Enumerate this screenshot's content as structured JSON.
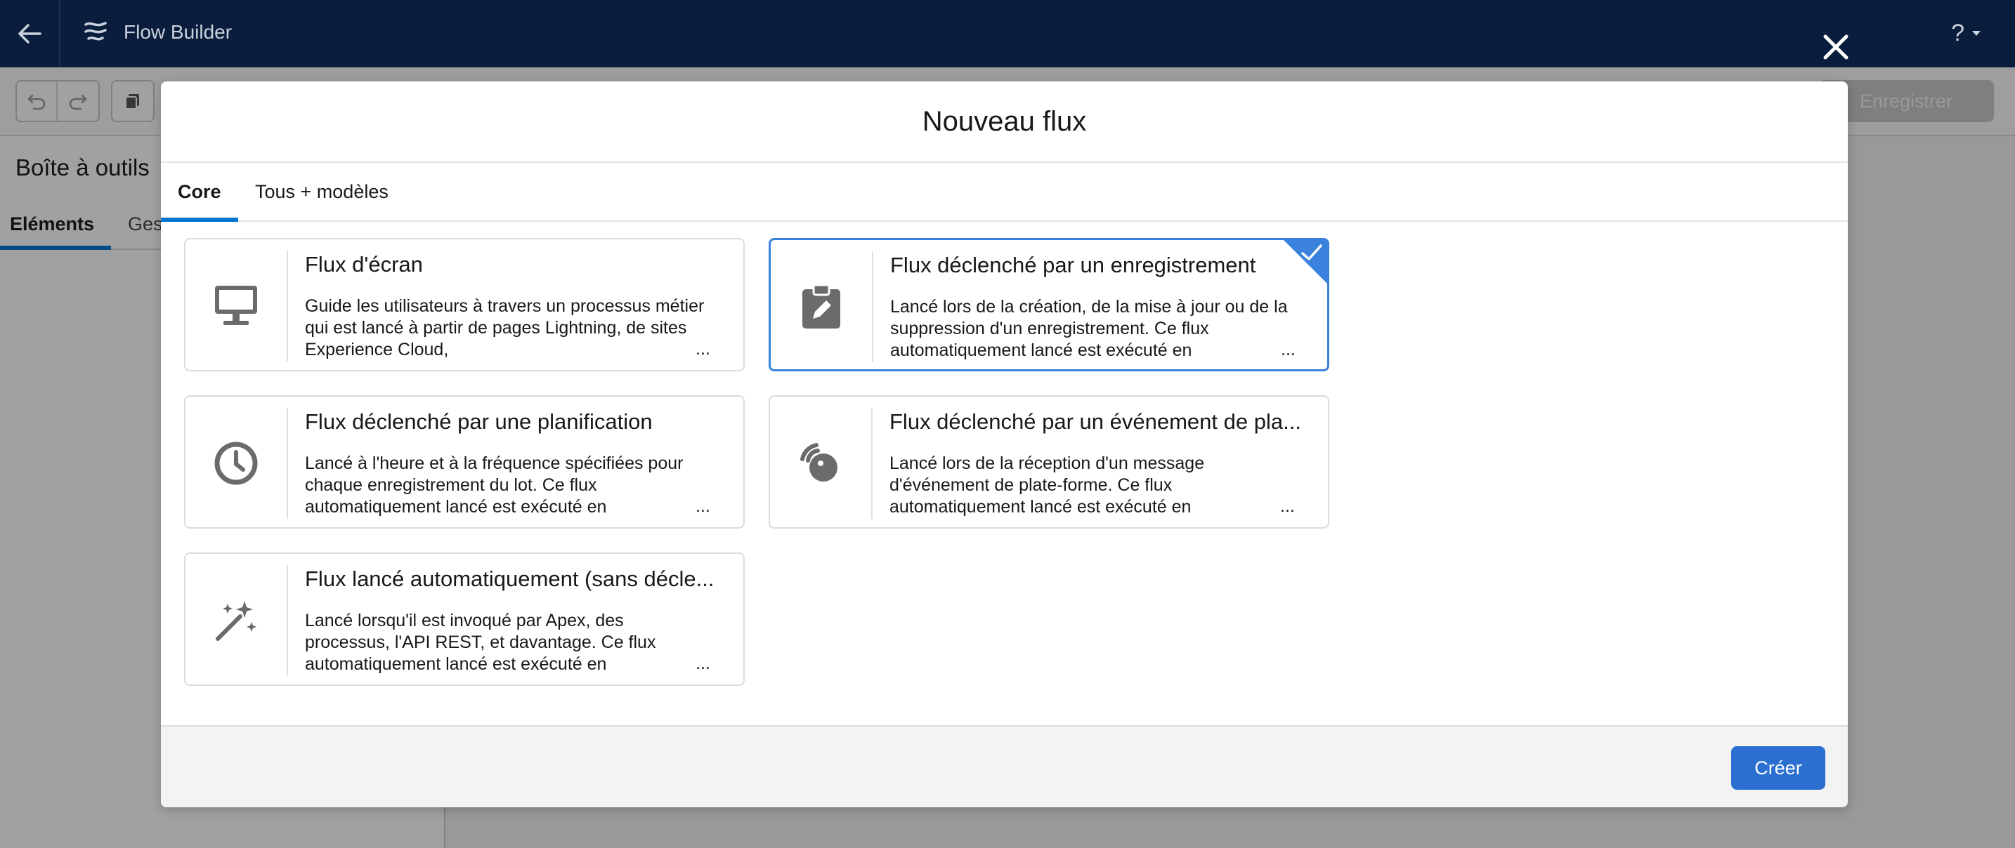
{
  "app": {
    "title": "Flow Builder",
    "help_label": "?"
  },
  "toolbar": {
    "save_label": "Enregistrer"
  },
  "toolbox": {
    "title": "Boîte à outils",
    "tabs": [
      "Eléments",
      "Ges"
    ]
  },
  "modal": {
    "title": "Nouveau flux",
    "tabs": [
      {
        "label": "Core",
        "active": true
      },
      {
        "label": "Tous + modèles",
        "active": false
      }
    ],
    "cards": [
      {
        "icon": "monitor-icon",
        "title": "Flux d'écran",
        "description": "Guide les utilisateurs à travers un processus métier qui est lancé à partir de pages Lightning, de sites Experience Cloud,",
        "more": "...",
        "selected": false
      },
      {
        "icon": "clipboard-edit-icon",
        "title": "Flux déclenché par un enregistrement",
        "description": "Lancé lors de la création, de la mise à jour ou de la suppression d'un enregistrement. Ce flux automatiquement lancé est exécuté en",
        "more": "...",
        "selected": true
      },
      {
        "icon": "clock-icon",
        "title": "Flux déclenché par une planification",
        "description": "Lancé à l'heure et à la fréquence spécifiées pour chaque enregistrement du lot. Ce flux automatiquement lancé est exécuté en",
        "more": "...",
        "selected": false
      },
      {
        "icon": "platform-event-icon",
        "title": "Flux déclenché par un événement de pla...",
        "description": "Lancé lors de la réception d'un message d'événement de plate-forme. Ce flux automatiquement lancé est exécuté en",
        "more": "...",
        "selected": false
      },
      {
        "icon": "magic-wand-icon",
        "title": "Flux lancé automatiquement (sans décle...",
        "description": "Lancé lorsqu'il est invoqué par Apex, des processus, l'API REST, et davantage. Ce flux automatiquement lancé est exécuté en",
        "more": "...",
        "selected": false
      }
    ],
    "create_label": "Créer"
  },
  "colors": {
    "header_bg": "#0b1d3d",
    "accent": "#0176d3",
    "selected_border": "#3b82dc",
    "create_button": "#2b6fd1"
  }
}
